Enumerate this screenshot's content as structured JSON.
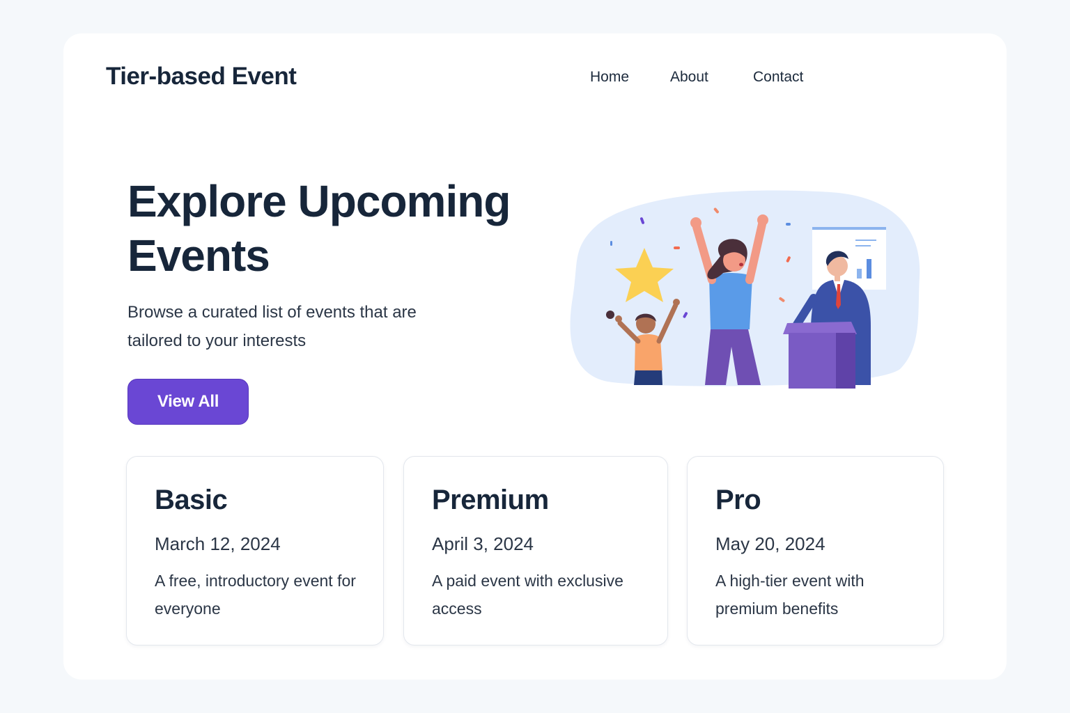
{
  "brand": "Tier-based Event",
  "nav": {
    "home": "Home",
    "about": "About",
    "contact": "Contact"
  },
  "hero": {
    "title": "Explore Upcoming Events",
    "subtitle": "Browse a curated list of events that are tailored to your interests",
    "button_label": "View All"
  },
  "tiers": [
    {
      "name": "Basic",
      "date": "March 12, 2024",
      "description": "A free, introductory event for everyone"
    },
    {
      "name": "Premium",
      "date": "April 3, 2024",
      "description": "A paid event with exclusive access"
    },
    {
      "name": "Pro",
      "date": "May 20, 2024",
      "description": "A high-tier event with premium benefits"
    }
  ],
  "colors": {
    "accent": "#6a47d4",
    "text": "#17263a",
    "background": "#f5f8fb",
    "illustration_blob": "#e3edfc"
  }
}
